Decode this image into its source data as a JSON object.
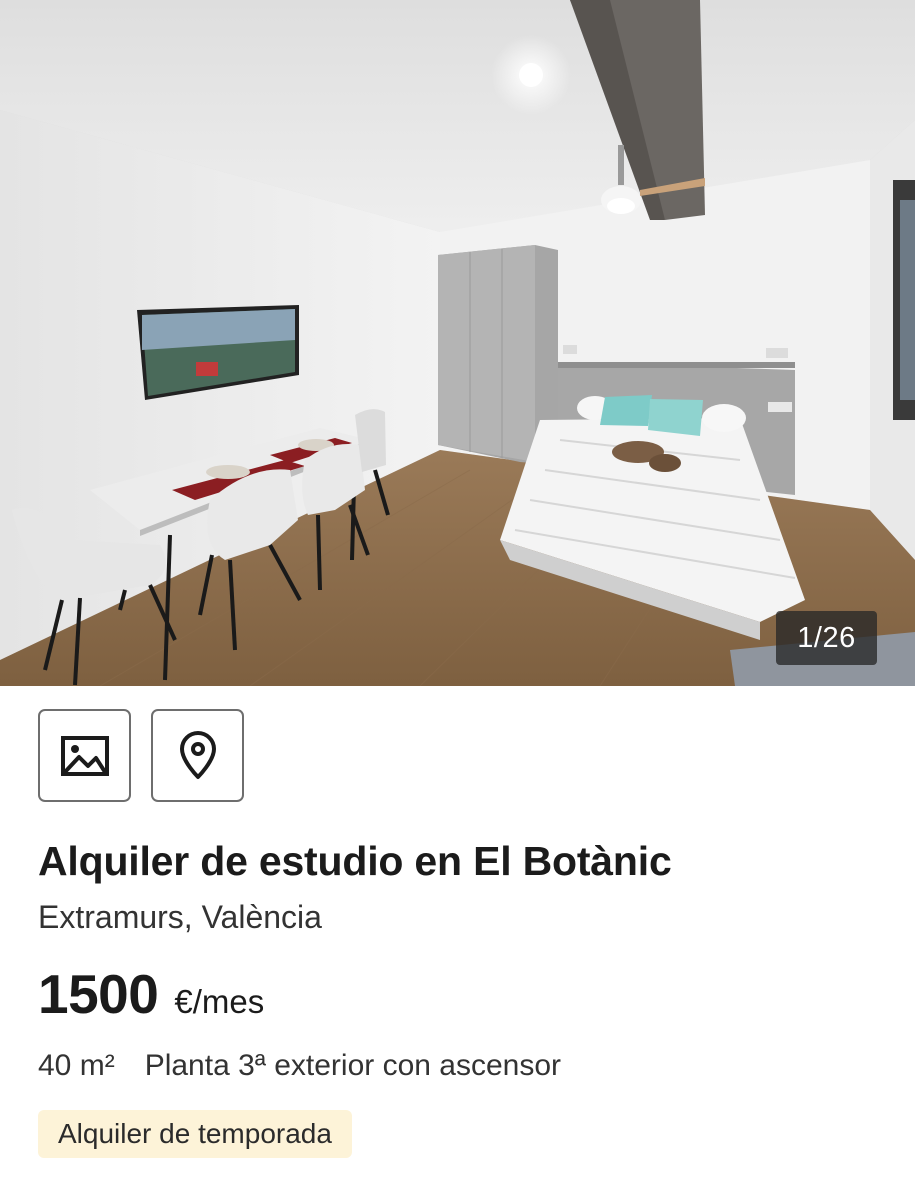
{
  "gallery": {
    "counter": "1/26",
    "photos_icon": "image-icon",
    "map_icon": "map-pin-icon"
  },
  "listing": {
    "title": "Alquiler de estudio en El Botànic",
    "location": "Extramurs, València",
    "price": "1500",
    "price_unit": "€/mes",
    "area": "40 m²",
    "floor": "Planta 3ª exterior con ascensor",
    "tag": "Alquiler de temporada"
  },
  "colors": {
    "tag_bg": "#fdf3d8",
    "text": "#1b1b1b"
  }
}
